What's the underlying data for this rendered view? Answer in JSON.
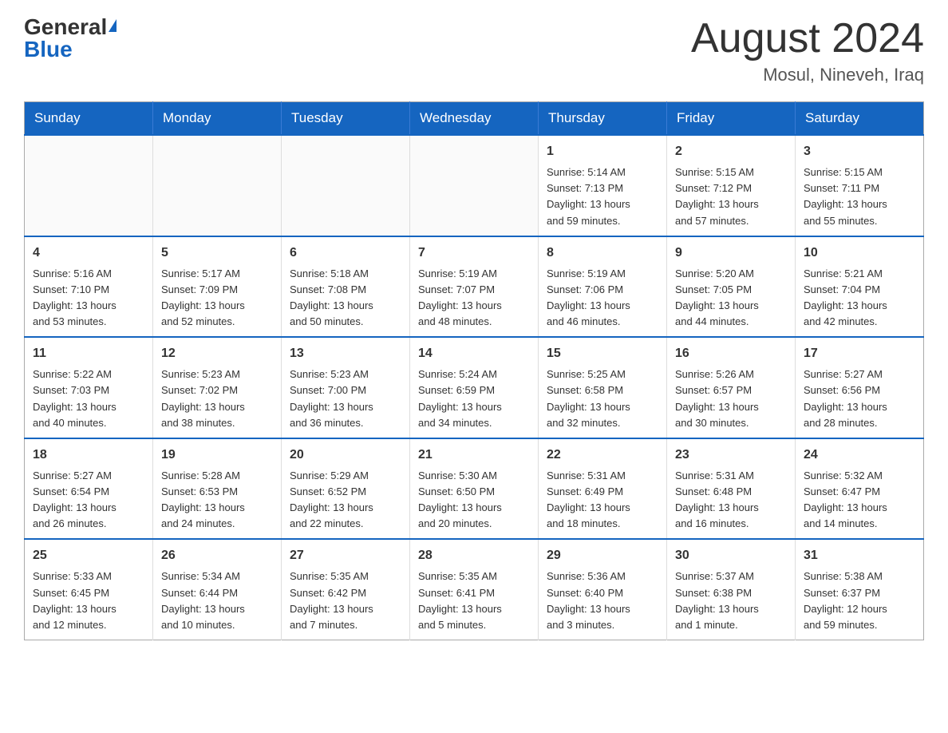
{
  "logo": {
    "general": "General",
    "blue": "Blue"
  },
  "title": "August 2024",
  "subtitle": "Mosul, Nineveh, Iraq",
  "days_of_week": [
    "Sunday",
    "Monday",
    "Tuesday",
    "Wednesday",
    "Thursday",
    "Friday",
    "Saturday"
  ],
  "weeks": [
    {
      "days": [
        {
          "number": "",
          "info": ""
        },
        {
          "number": "",
          "info": ""
        },
        {
          "number": "",
          "info": ""
        },
        {
          "number": "",
          "info": ""
        },
        {
          "number": "1",
          "info": "Sunrise: 5:14 AM\nSunset: 7:13 PM\nDaylight: 13 hours\nand 59 minutes."
        },
        {
          "number": "2",
          "info": "Sunrise: 5:15 AM\nSunset: 7:12 PM\nDaylight: 13 hours\nand 57 minutes."
        },
        {
          "number": "3",
          "info": "Sunrise: 5:15 AM\nSunset: 7:11 PM\nDaylight: 13 hours\nand 55 minutes."
        }
      ]
    },
    {
      "days": [
        {
          "number": "4",
          "info": "Sunrise: 5:16 AM\nSunset: 7:10 PM\nDaylight: 13 hours\nand 53 minutes."
        },
        {
          "number": "5",
          "info": "Sunrise: 5:17 AM\nSunset: 7:09 PM\nDaylight: 13 hours\nand 52 minutes."
        },
        {
          "number": "6",
          "info": "Sunrise: 5:18 AM\nSunset: 7:08 PM\nDaylight: 13 hours\nand 50 minutes."
        },
        {
          "number": "7",
          "info": "Sunrise: 5:19 AM\nSunset: 7:07 PM\nDaylight: 13 hours\nand 48 minutes."
        },
        {
          "number": "8",
          "info": "Sunrise: 5:19 AM\nSunset: 7:06 PM\nDaylight: 13 hours\nand 46 minutes."
        },
        {
          "number": "9",
          "info": "Sunrise: 5:20 AM\nSunset: 7:05 PM\nDaylight: 13 hours\nand 44 minutes."
        },
        {
          "number": "10",
          "info": "Sunrise: 5:21 AM\nSunset: 7:04 PM\nDaylight: 13 hours\nand 42 minutes."
        }
      ]
    },
    {
      "days": [
        {
          "number": "11",
          "info": "Sunrise: 5:22 AM\nSunset: 7:03 PM\nDaylight: 13 hours\nand 40 minutes."
        },
        {
          "number": "12",
          "info": "Sunrise: 5:23 AM\nSunset: 7:02 PM\nDaylight: 13 hours\nand 38 minutes."
        },
        {
          "number": "13",
          "info": "Sunrise: 5:23 AM\nSunset: 7:00 PM\nDaylight: 13 hours\nand 36 minutes."
        },
        {
          "number": "14",
          "info": "Sunrise: 5:24 AM\nSunset: 6:59 PM\nDaylight: 13 hours\nand 34 minutes."
        },
        {
          "number": "15",
          "info": "Sunrise: 5:25 AM\nSunset: 6:58 PM\nDaylight: 13 hours\nand 32 minutes."
        },
        {
          "number": "16",
          "info": "Sunrise: 5:26 AM\nSunset: 6:57 PM\nDaylight: 13 hours\nand 30 minutes."
        },
        {
          "number": "17",
          "info": "Sunrise: 5:27 AM\nSunset: 6:56 PM\nDaylight: 13 hours\nand 28 minutes."
        }
      ]
    },
    {
      "days": [
        {
          "number": "18",
          "info": "Sunrise: 5:27 AM\nSunset: 6:54 PM\nDaylight: 13 hours\nand 26 minutes."
        },
        {
          "number": "19",
          "info": "Sunrise: 5:28 AM\nSunset: 6:53 PM\nDaylight: 13 hours\nand 24 minutes."
        },
        {
          "number": "20",
          "info": "Sunrise: 5:29 AM\nSunset: 6:52 PM\nDaylight: 13 hours\nand 22 minutes."
        },
        {
          "number": "21",
          "info": "Sunrise: 5:30 AM\nSunset: 6:50 PM\nDaylight: 13 hours\nand 20 minutes."
        },
        {
          "number": "22",
          "info": "Sunrise: 5:31 AM\nSunset: 6:49 PM\nDaylight: 13 hours\nand 18 minutes."
        },
        {
          "number": "23",
          "info": "Sunrise: 5:31 AM\nSunset: 6:48 PM\nDaylight: 13 hours\nand 16 minutes."
        },
        {
          "number": "24",
          "info": "Sunrise: 5:32 AM\nSunset: 6:47 PM\nDaylight: 13 hours\nand 14 minutes."
        }
      ]
    },
    {
      "days": [
        {
          "number": "25",
          "info": "Sunrise: 5:33 AM\nSunset: 6:45 PM\nDaylight: 13 hours\nand 12 minutes."
        },
        {
          "number": "26",
          "info": "Sunrise: 5:34 AM\nSunset: 6:44 PM\nDaylight: 13 hours\nand 10 minutes."
        },
        {
          "number": "27",
          "info": "Sunrise: 5:35 AM\nSunset: 6:42 PM\nDaylight: 13 hours\nand 7 minutes."
        },
        {
          "number": "28",
          "info": "Sunrise: 5:35 AM\nSunset: 6:41 PM\nDaylight: 13 hours\nand 5 minutes."
        },
        {
          "number": "29",
          "info": "Sunrise: 5:36 AM\nSunset: 6:40 PM\nDaylight: 13 hours\nand 3 minutes."
        },
        {
          "number": "30",
          "info": "Sunrise: 5:37 AM\nSunset: 6:38 PM\nDaylight: 13 hours\nand 1 minute."
        },
        {
          "number": "31",
          "info": "Sunrise: 5:38 AM\nSunset: 6:37 PM\nDaylight: 12 hours\nand 59 minutes."
        }
      ]
    }
  ]
}
